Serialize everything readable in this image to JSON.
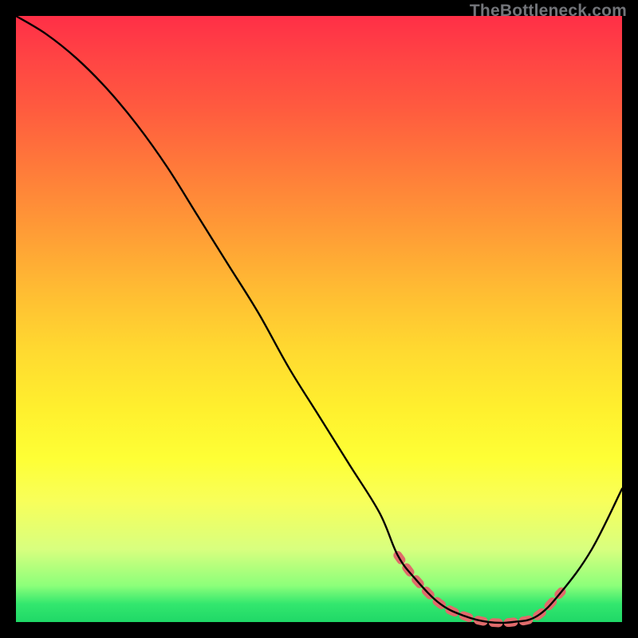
{
  "watermark": "TheBottleneck.com",
  "chart_data": {
    "type": "line",
    "title": "",
    "xlabel": "",
    "ylabel": "",
    "xlim": [
      0,
      100
    ],
    "ylim": [
      0,
      100
    ],
    "grid": false,
    "legend": false,
    "background_gradient": {
      "direction": "top-to-bottom",
      "stops": [
        {
          "pct": 0,
          "color": "#ff2f47"
        },
        {
          "pct": 25,
          "color": "#ff7a3a"
        },
        {
          "pct": 50,
          "color": "#ffd02f"
        },
        {
          "pct": 75,
          "color": "#feff35"
        },
        {
          "pct": 100,
          "color": "#1fd867"
        }
      ]
    },
    "series": [
      {
        "name": "bottleneck-curve",
        "color": "#000000",
        "x": [
          0,
          5,
          10,
          15,
          20,
          25,
          30,
          35,
          40,
          45,
          50,
          55,
          60,
          63,
          66,
          70,
          74,
          78,
          82,
          86,
          90,
          95,
          100
        ],
        "y": [
          100,
          97,
          93,
          88,
          82,
          75,
          67,
          59,
          51,
          42,
          34,
          26,
          18,
          11,
          7,
          3,
          1,
          0,
          0,
          1,
          5,
          12,
          22
        ]
      },
      {
        "name": "optimal-range-dashed",
        "color": "#e06b6b",
        "style": "dashed",
        "x": [
          63,
          66,
          70,
          74,
          78,
          82,
          86,
          90
        ],
        "y": [
          11,
          7,
          3,
          1,
          0,
          0,
          1,
          5
        ]
      }
    ],
    "annotations": []
  }
}
